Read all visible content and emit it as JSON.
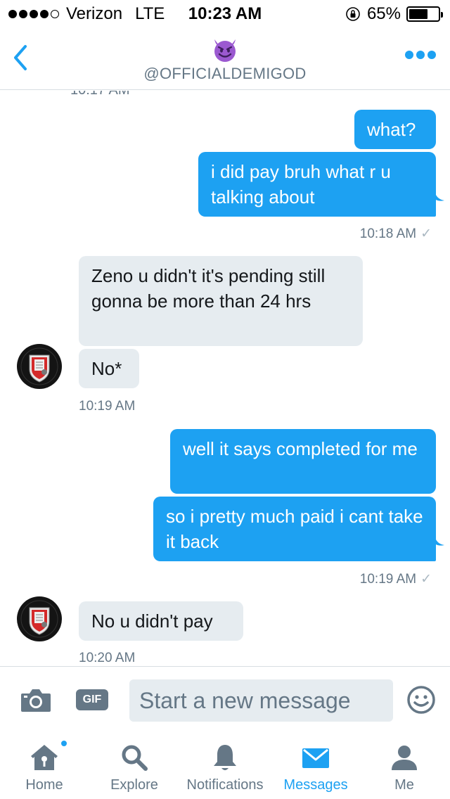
{
  "status_bar": {
    "carrier": "Verizon",
    "network": "LTE",
    "time": "10:23 AM",
    "battery": "65%",
    "battery_level": 0.65,
    "signal_bars": 4
  },
  "header": {
    "handle": "@OFFICIALDEMIGOD",
    "avatar_emoji": "smiling-devil-icon",
    "accent_color": "#1da1f2"
  },
  "conversation": {
    "cut_off_timestamp": "10:17 AM",
    "messages": [
      {
        "direction": "out",
        "text": "what?"
      },
      {
        "direction": "out",
        "text": "i did pay bruh what r u talking about"
      },
      {
        "type": "timestamp",
        "text": "10:18 AM"
      },
      {
        "direction": "in",
        "text": "Zeno u didn't it's pending still gonna be more than 24 hrs"
      },
      {
        "direction": "in",
        "text": "No*"
      },
      {
        "type": "timestamp",
        "text": "10:19 AM"
      },
      {
        "direction": "out",
        "text": "well it says completed for me"
      },
      {
        "direction": "out",
        "text": "so i pretty much paid i cant take it back"
      },
      {
        "type": "timestamp",
        "text": "10:19 AM"
      },
      {
        "direction": "in",
        "text": "No u didn't pay"
      },
      {
        "type": "timestamp",
        "text": "10:20 AM"
      }
    ]
  },
  "composer": {
    "gif_label": "GIF",
    "placeholder": "Start a new message"
  },
  "tabs": [
    {
      "label": "Home",
      "icon": "home-icon",
      "has_badge": true
    },
    {
      "label": "Explore",
      "icon": "search-icon"
    },
    {
      "label": "Notifications",
      "icon": "bell-icon"
    },
    {
      "label": "Messages",
      "icon": "envelope-icon",
      "active": true
    },
    {
      "label": "Me",
      "icon": "person-icon"
    }
  ],
  "colors": {
    "outgoing_bubble": "#1da1f2",
    "incoming_bubble": "#e6ecf0",
    "muted_text": "#657786"
  }
}
